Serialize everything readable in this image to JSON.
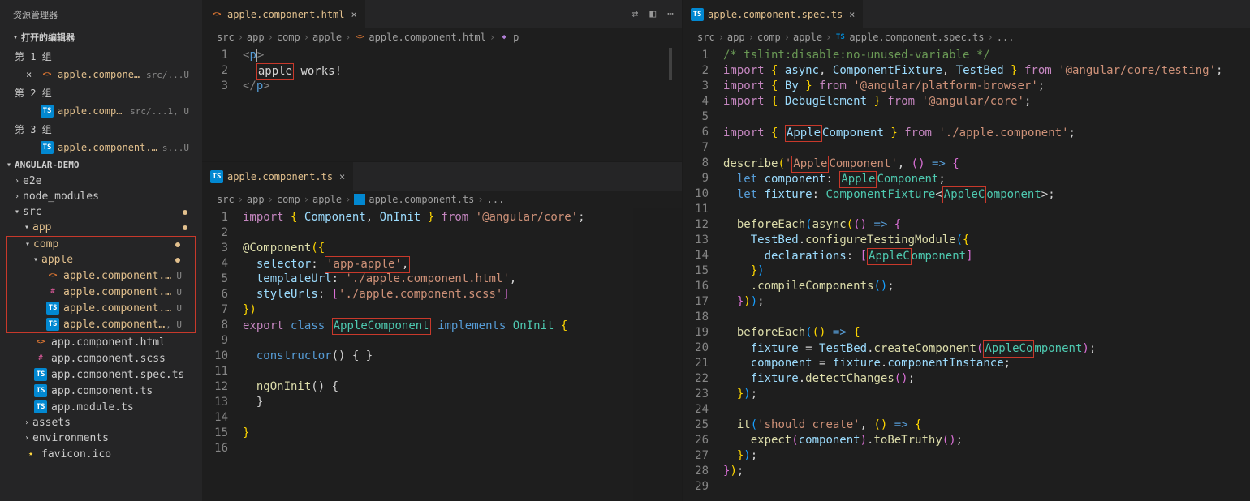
{
  "explorer": {
    "title": "资源管理器"
  },
  "openEditors": {
    "title": "打开的编辑器",
    "groups": [
      {
        "label": "第 1 组",
        "items": [
          {
            "icon": "html",
            "name": "apple.component.html",
            "path": "src/...",
            "status": "U",
            "hasClose": true
          }
        ]
      },
      {
        "label": "第 2 组",
        "items": [
          {
            "icon": "ts",
            "name": "apple.component.ts",
            "path": "src/...",
            "status": "1, U"
          }
        ]
      },
      {
        "label": "第 3 组",
        "items": [
          {
            "icon": "ts",
            "name": "apple.component.spec.ts",
            "path": "s...",
            "status": "U"
          }
        ]
      }
    ]
  },
  "project": {
    "name": "ANGULAR-DEMO",
    "tree": {
      "e2e": "e2e",
      "node_modules": "node_modules",
      "src": "src",
      "app": "app",
      "comp": "comp",
      "apple": "apple",
      "files_apple": [
        "apple.component.html",
        "apple.component.scss",
        "apple.component.spec.ts",
        "apple.component.ts"
      ],
      "files_app": [
        "app.component.html",
        "app.component.scss",
        "app.component.spec.ts",
        "app.component.ts",
        "app.module.ts"
      ],
      "assets": "assets",
      "environments": "environments",
      "favicon": "favicon.ico"
    },
    "u": "U",
    "dotu": ", U"
  },
  "pane1": {
    "tab": "apple.component.html",
    "crumbs": [
      "src",
      "app",
      "comp",
      "apple",
      "apple.component.html",
      "p"
    ],
    "code": [
      {
        "n": "1",
        "html": "<p|>"
      },
      {
        "n": "2",
        "boxed": "apple",
        "after": " works!"
      },
      {
        "n": "3",
        "html": "</p>"
      }
    ]
  },
  "pane2": {
    "tab": "apple.component.ts",
    "crumbs": [
      "src",
      "app",
      "comp",
      "apple",
      "apple.component.ts",
      "..."
    ],
    "code_lines": 16
  },
  "pane3": {
    "tab": "apple.component.spec.ts",
    "crumbs": [
      "src",
      "app",
      "comp",
      "apple",
      "apple.component.spec.ts",
      "..."
    ],
    "code_lines": 29
  },
  "code2": {
    "l1_a": "import",
    "l1_b": "Component",
    "l1_c": "OnInit",
    "l1_d": "from",
    "l1_e": "'@angular/core'",
    "l3": "@Component",
    "l3b": "({",
    "l4a": "selector",
    "l4b": "'app-apple'",
    "l5a": "templateUrl",
    "l5b": "'./apple.component.html'",
    "l6a": "styleUrls",
    "l6b": "'./apple.component.scss'",
    "l7": "})",
    "l8a": "export",
    "l8b": "class",
    "l8c": "AppleComponent",
    "l8d": "implements",
    "l8e": "OnInit",
    "l10": "constructor",
    "l10b": "() { }",
    "l12": "ngOnInit",
    "l12b": "() {"
  },
  "code3": {
    "l1": "/* tslint:disable:no-unused-variable */",
    "l2a": "import",
    "l2b": "async",
    "l2c": "ComponentFixture",
    "l2d": "TestBed",
    "l2e": "from",
    "l2f": "'@angular/core/testing'",
    "l3b": "By",
    "l3f": "'@angular/platform-browser'",
    "l4b": "DebugElement",
    "l4f": "'@angular/core'",
    "l6b": "Apple",
    "l6c": "Component",
    "l6f": "'./apple.component'",
    "l8a": "describe",
    "l8b": "'",
    "l8c": "Apple",
    "l8d": "Component'",
    "l9a": "let",
    "l9b": "component",
    "l9c": "Apple",
    "l9d": "Component",
    "l10b": "fixture",
    "l10c": "ComponentFixture",
    "l10d": "AppleC",
    "l10e": "omponent",
    "l12": "beforeEach",
    "l12b": "async",
    "l13a": "TestBed",
    "l13b": "configureTestingModule",
    "l14a": "declarations",
    "l14b": "AppleC",
    "l14c": "omponent",
    "l16": ".compileComponents",
    "l20a": "fixture",
    "l20b": "TestBed",
    "l20c": "createComponent",
    "l20d": "AppleCo",
    "l20e": "mponent",
    "l21a": "component",
    "l21b": "fixture",
    "l21c": "componentInstance",
    "l22a": "fixture",
    "l22b": "detectChanges",
    "l25a": "it",
    "l25b": "'should create'",
    "l26a": "expect",
    "l26b": "component",
    "l26c": "toBeTruthy"
  }
}
